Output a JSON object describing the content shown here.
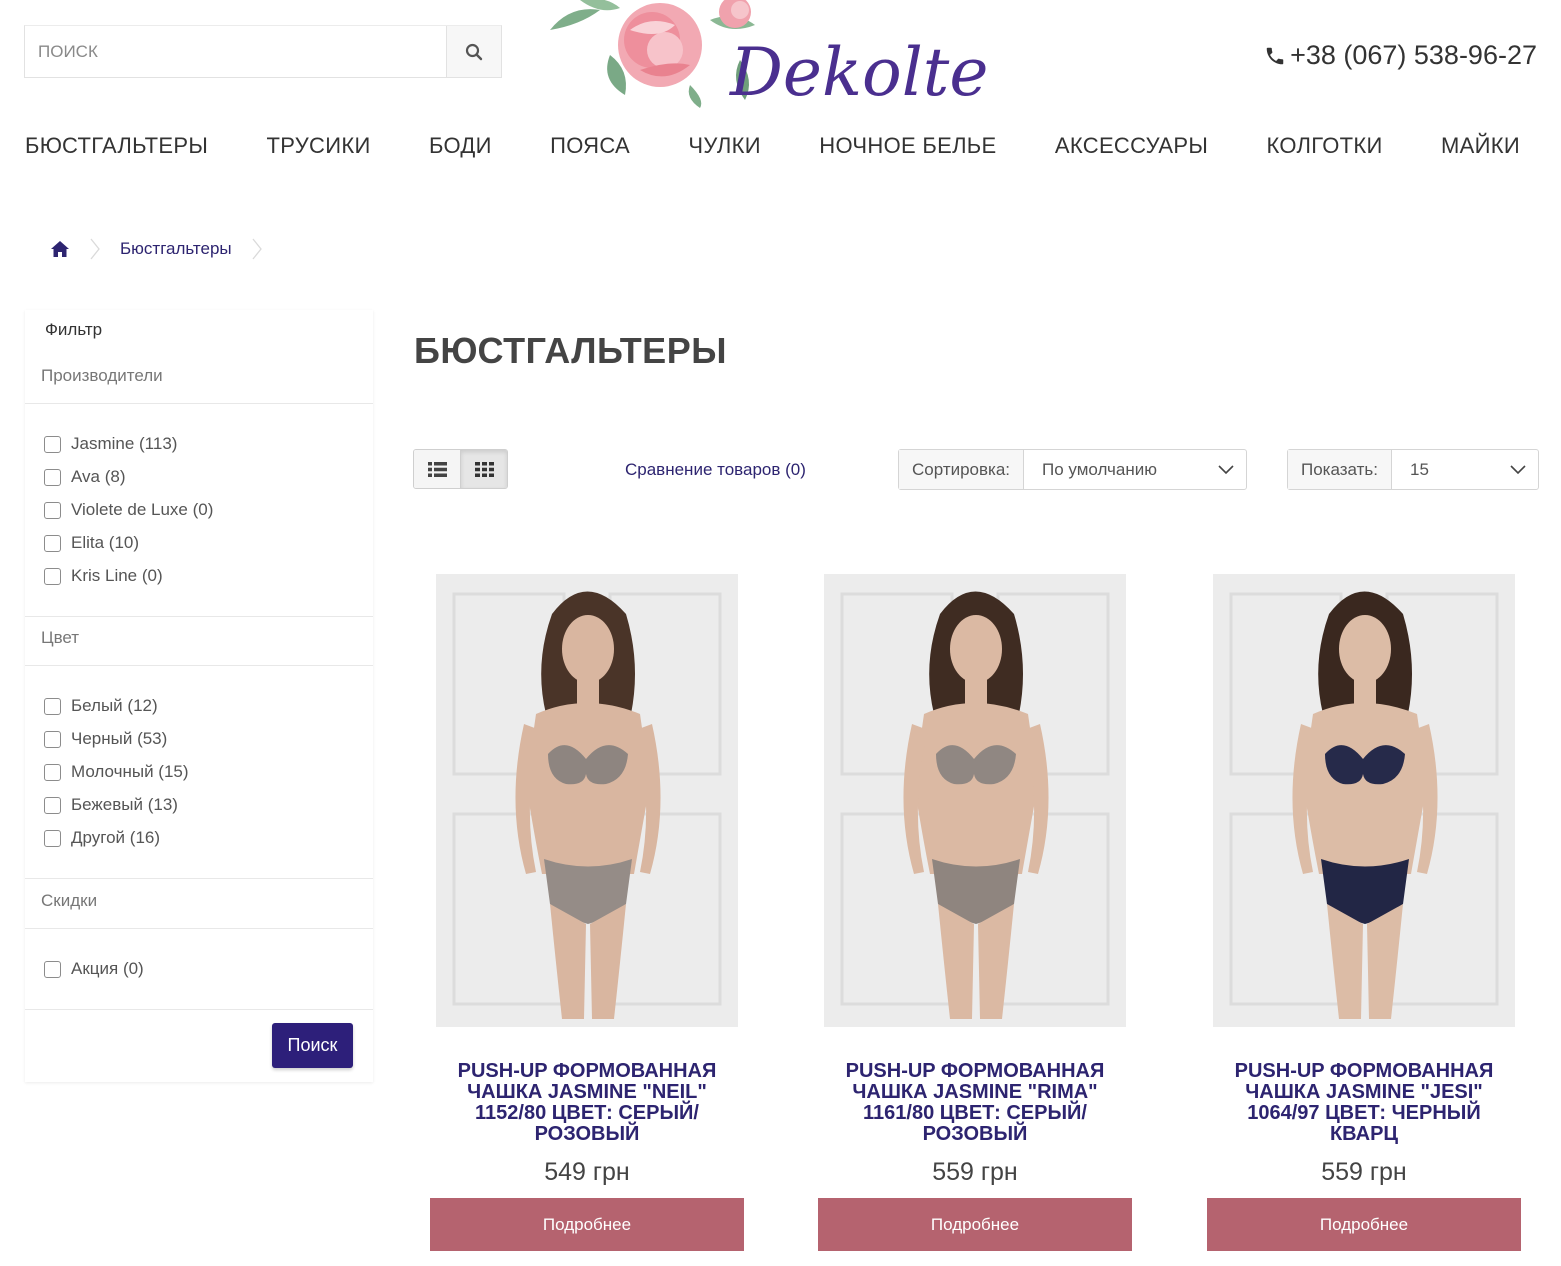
{
  "header": {
    "search_placeholder": "ПОИСК",
    "logo_text": "Dekolte",
    "phone": "+38 (067) 538-96-27"
  },
  "nav": {
    "items": [
      {
        "label": "БЮСТГАЛЬТЕРЫ"
      },
      {
        "label": "ТРУСИКИ"
      },
      {
        "label": "БОДИ"
      },
      {
        "label": "ПОЯСА"
      },
      {
        "label": "ЧУЛКИ"
      },
      {
        "label": "НОЧНОЕ БЕЛЬЕ"
      },
      {
        "label": "АКСЕССУАРЫ"
      },
      {
        "label": "КОЛГОТКИ"
      },
      {
        "label": "МАЙКИ"
      }
    ]
  },
  "breadcrumb": {
    "current": "Бюстгальтеры"
  },
  "filter": {
    "title": "Фильтр",
    "groups": [
      {
        "name": "Производители",
        "options": [
          "Jasmine (113)",
          "Ava (8)",
          "Violete de Luxe (0)",
          "Elita (10)",
          "Kris Line (0)"
        ]
      },
      {
        "name": "Цвет",
        "options": [
          "Белый (12)",
          "Черный (53)",
          "Молочный (15)",
          "Бежевый (13)",
          "Другой (16)"
        ]
      },
      {
        "name": "Скидки",
        "options": [
          "Акция (0)"
        ]
      }
    ],
    "submit_label": "Поиск"
  },
  "main": {
    "title": "БЮСТГАЛЬТЕРЫ",
    "compare_label": "Сравнение товаров (0)",
    "sort_label": "Сортировка:",
    "sort_value": "По умолчанию",
    "show_label": "Показать:",
    "show_value": "15"
  },
  "products": [
    {
      "name_lines": [
        "PUSH-UP ФОРМОВАННАЯ",
        "ЧАШКА JASMINE \"NEIL\"",
        "1152/80 ЦВЕТ: СЕРЫЙ/",
        "РОЗОВЫЙ"
      ],
      "price": "549 грн",
      "button": "Подробнее",
      "colors": {
        "bra": "#8e8580",
        "panty": "#958c87",
        "hair": "#4a3428",
        "skin": "#d9b6a0"
      }
    },
    {
      "name_lines": [
        "PUSH-UP ФОРМОВАННАЯ",
        "ЧАШКА JASMINE \"RIMA\"",
        "1161/80 ЦВЕТ: СЕРЫЙ/",
        "РОЗОВЫЙ"
      ],
      "price": "559 грн",
      "button": "Подробнее",
      "colors": {
        "bra": "#908782",
        "panty": "#8f857f",
        "hair": "#3f2c22",
        "skin": "#dbb9a3"
      }
    },
    {
      "name_lines": [
        "PUSH-UP ФОРМОВАННАЯ",
        "ЧАШКА JASMINE \"JESI\"",
        "1064/97 ЦВЕТ: ЧЕРНЫЙ",
        "КВАРЦ"
      ],
      "price": "559 грн",
      "button": "Подробнее",
      "colors": {
        "bra": "#262a4a",
        "panty": "#222645",
        "hair": "#3a281f",
        "skin": "#dcbca6"
      }
    }
  ],
  "colors": {
    "accent": "#2d2470",
    "button_primary": "#2d1f7a",
    "button_more": "#b5636f"
  }
}
